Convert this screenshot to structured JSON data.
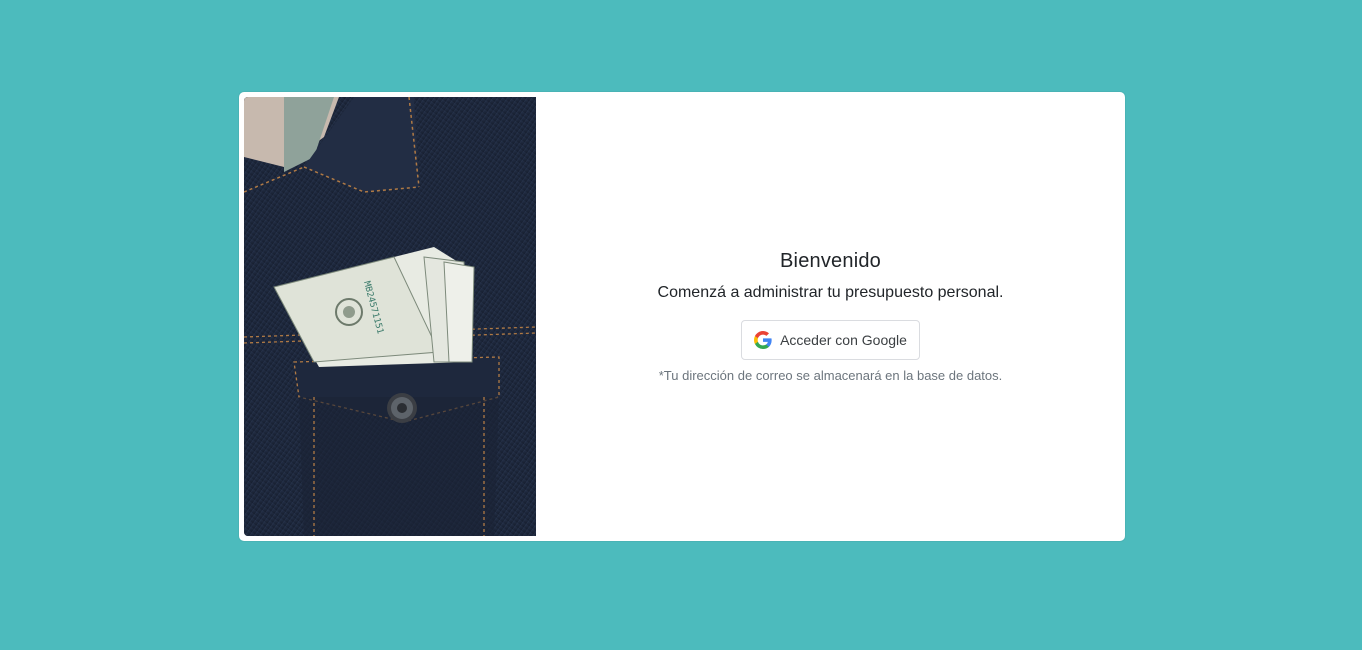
{
  "colors": {
    "background": "#4cbbbd",
    "card": "#ffffff",
    "text": "#212529",
    "muted": "#6c757d"
  },
  "hero_image": {
    "description_icon": "money-in-denim-pocket-photo"
  },
  "login": {
    "title": "Bienvenido",
    "subtitle": "Comenzá a administrar tu presupuesto personal.",
    "google_button_label": "Acceder con Google",
    "google_icon": "google-g-icon",
    "note": "*Tu dirección de correo se almacenará en la base de datos."
  }
}
